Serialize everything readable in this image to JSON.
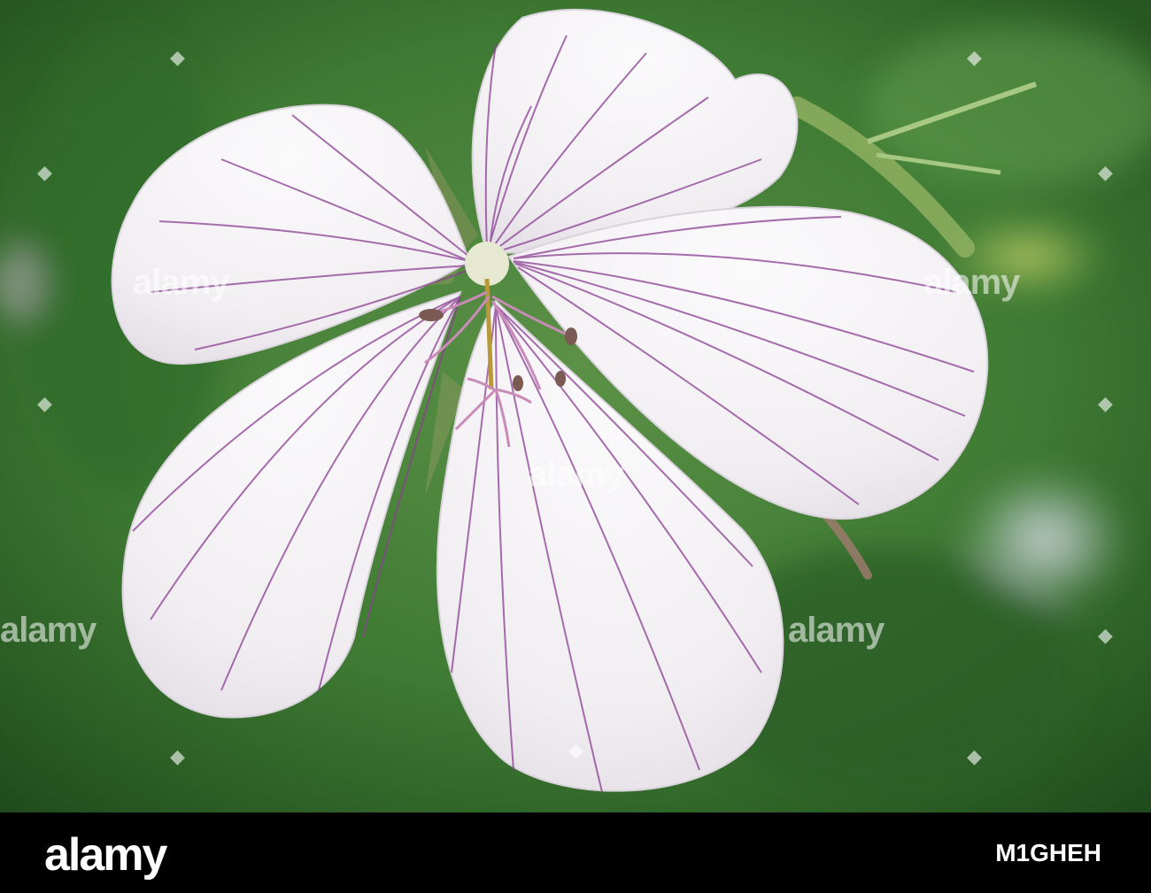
{
  "photo": {
    "subject": "white flower with purple veins",
    "background_color": "#3f7a35",
    "petal_color": "#f4f2f4",
    "vein_color": "#8a3f92",
    "stamen_color": "#c98bb8"
  },
  "watermark": {
    "text": "alamy"
  },
  "footer": {
    "logo": "alamy",
    "image_id": "M1GHEH"
  }
}
